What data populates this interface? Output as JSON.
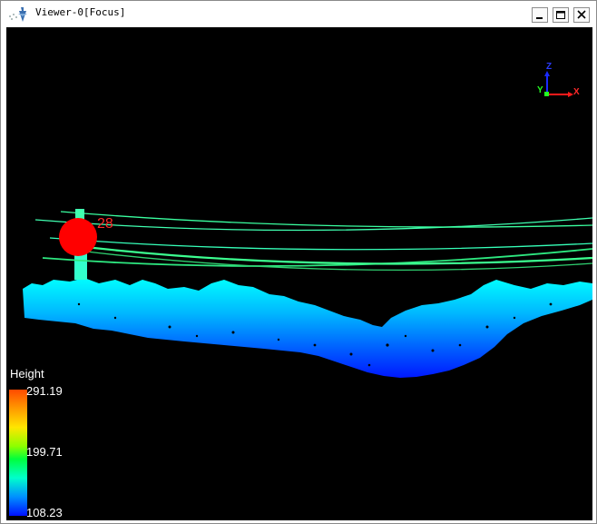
{
  "window": {
    "title": "Viewer-0[Focus]"
  },
  "legend": {
    "title": "Height",
    "max": "291.19",
    "mid": "199.71",
    "min": "108.23"
  },
  "marker": {
    "label": "28",
    "color": "#ff0000"
  },
  "axes": {
    "z": "Z",
    "y": "Y",
    "x": "X"
  },
  "colors": {
    "background": "#000000",
    "ground_high": "#00ffff",
    "ground_low": "#0000ff",
    "wires": "#33ff66"
  }
}
